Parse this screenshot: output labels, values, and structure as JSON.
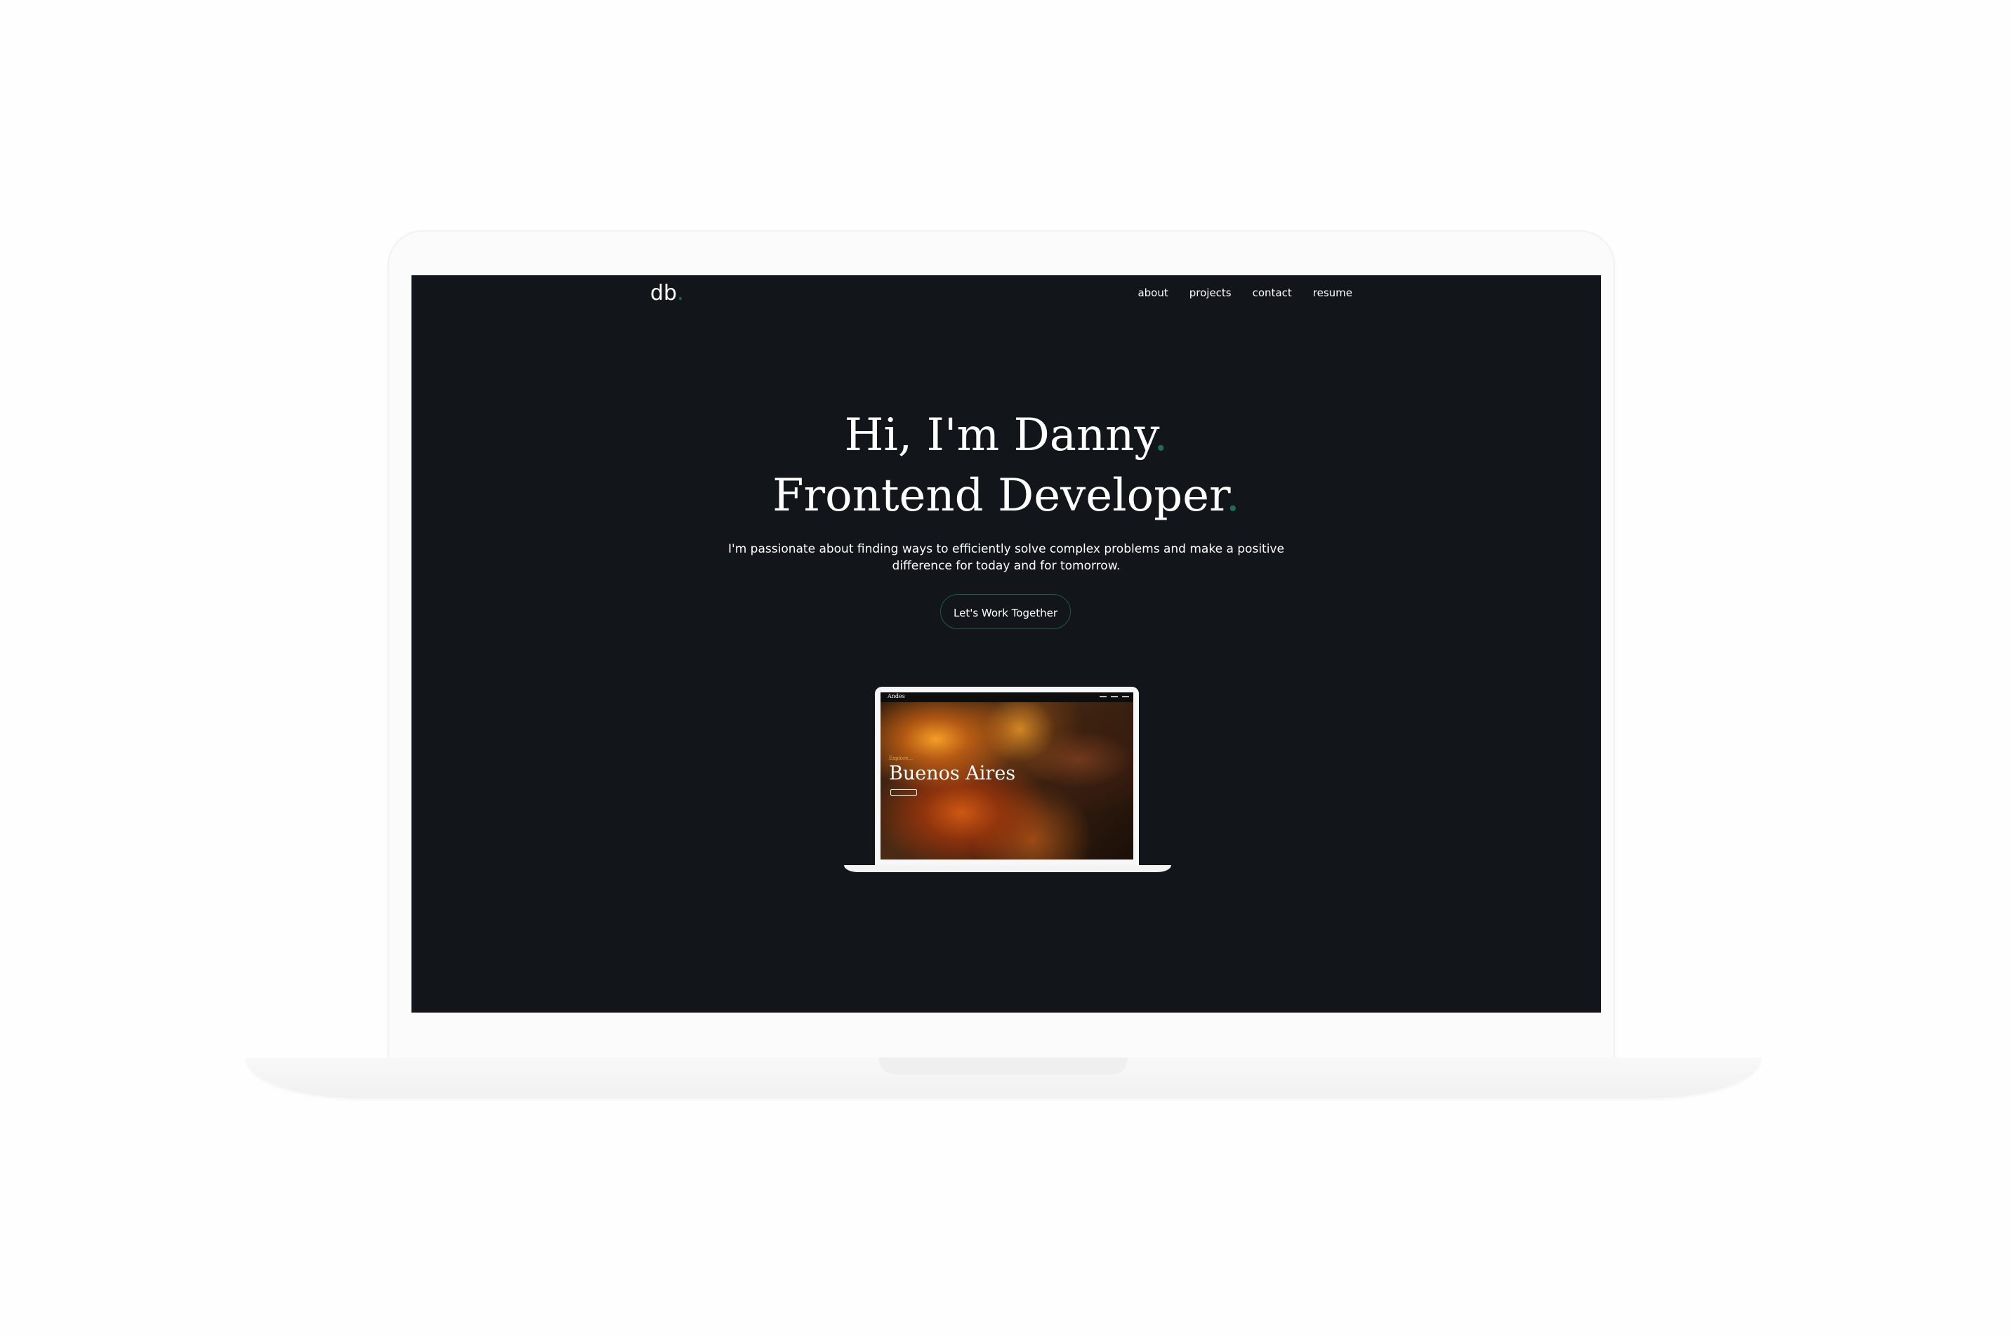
{
  "site": {
    "logo": "db",
    "logo_dot": ".",
    "nav": [
      {
        "label": "about"
      },
      {
        "label": "projects"
      },
      {
        "label": "contact"
      },
      {
        "label": "resume"
      }
    ],
    "hero": {
      "line1": "Hi, I'm Danny",
      "line2": "Frontend Developer",
      "accent": ".",
      "description": "I'm passionate about finding ways to efficiently solve complex problems and make a positive difference for today and for tomorrow.",
      "cta_label": "Let's Work Together"
    },
    "preview": {
      "logo": "Andes",
      "kicker": "Explore...",
      "title": "Buenos Aires"
    }
  },
  "colors": {
    "background": "#12151a",
    "accent": "#1f6b55",
    "text": "#ffffff"
  }
}
